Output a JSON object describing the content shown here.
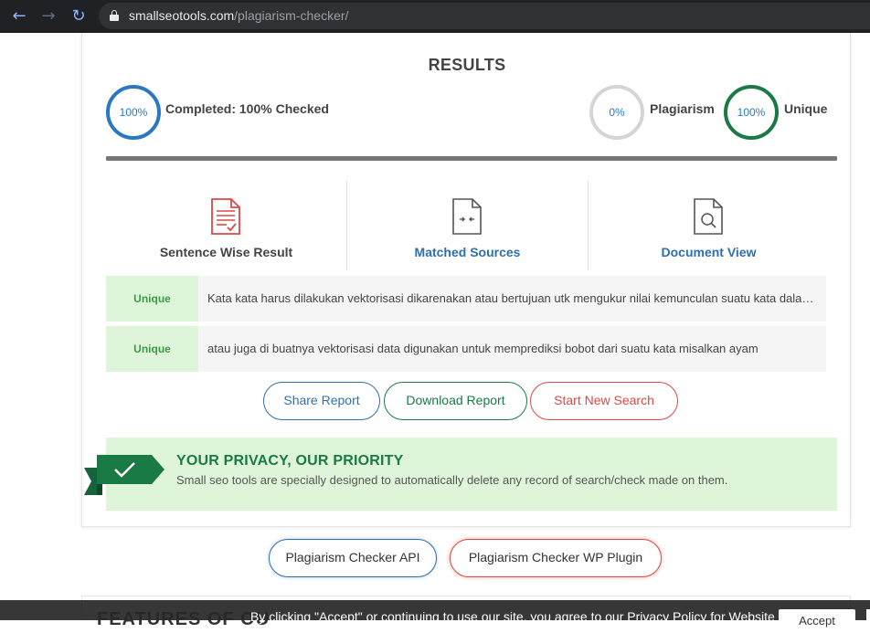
{
  "browser": {
    "url_host": "smallseotools.com",
    "url_path": "/plagiarism-checker/",
    "back_icon": "←",
    "forward_icon": "→",
    "reload_icon": "↻"
  },
  "results": {
    "title": "RESULTS",
    "completed": {
      "percent_text": "100%",
      "label": "Completed: 100% Checked",
      "value": 100
    },
    "plagiarism": {
      "percent_text": "0%",
      "label": "Plagiarism",
      "value": 0
    },
    "unique": {
      "percent_text": "100%",
      "label": "Unique",
      "value": 100
    }
  },
  "tabs": [
    {
      "label": "Sentence Wise Result",
      "icon": "document-lines-icon"
    },
    {
      "label": "Matched Sources",
      "icon": "compare-arrows-icon"
    },
    {
      "label": "Document View",
      "icon": "document-search-icon"
    }
  ],
  "sentences": [
    {
      "status": "Unique",
      "text": "Kata kata harus dilakukan vektorisasi dikarenakan atau bertujuan utk mengukur nilai kemunculan suatu kata dalam dokumen"
    },
    {
      "status": "Unique",
      "text": "atau juga di buatnya vektorisasi data digunakan untuk memprediksi bobot dari suatu kata misalkan ayam"
    }
  ],
  "actions": {
    "share": "Share Report",
    "download": "Download Report",
    "new_search": "Start New Search"
  },
  "privacy": {
    "title": "YOUR PRIVACY, OUR PRIORITY",
    "text": "Small seo tools are specially designed to automatically delete any record of search/check made on them."
  },
  "extras": {
    "api": "Plagiarism Checker API",
    "wp_plugin": "Plagiarism Checker WP Plugin"
  },
  "features": {
    "title": "FEATURES OF OU"
  },
  "cookie": {
    "text": "By clicking \"Accept\" or continuing to use our site, you agree to our Privacy Policy for Website",
    "accept": "Accept"
  },
  "colors": {
    "blue": "#2f6fb0",
    "green": "#1a7a45",
    "red": "#e04646",
    "unique_bg": "#dff5d9"
  }
}
